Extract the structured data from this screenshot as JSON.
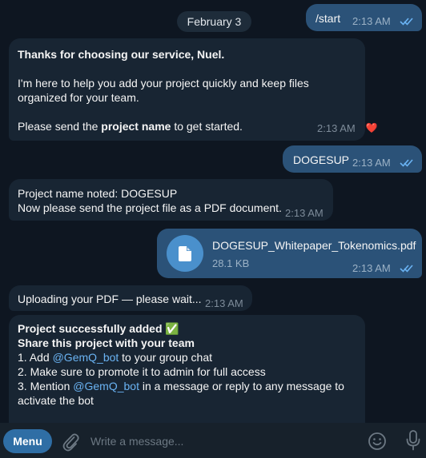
{
  "date_separator": "February 3",
  "messages": [
    {
      "text": "/start",
      "time": "2:13 AM"
    },
    {
      "line1": "Thanks for choosing our service, Nuel.",
      "line2": "I'm here to help you add your project quickly and keep files",
      "line3": "organized for your team.",
      "line4_pre": "Please send the ",
      "line4_bold": "project name",
      "line4_post": " to get started.",
      "time": "2:13 AM",
      "reaction": "❤️"
    },
    {
      "text": "DOGESUP",
      "time": "2:13 AM"
    },
    {
      "line1": "Project name noted: DOGESUP",
      "line2": "Now please send the project file as a PDF document.",
      "time": "2:13 AM"
    },
    {
      "file_name": "DOGESUP_Whitepaper_Tokenomics.pdf",
      "file_size": "28.1 KB",
      "time": "2:13 AM"
    },
    {
      "text": "Uploading your PDF — please wait...",
      "time": "2:13 AM"
    },
    {
      "line1": "Project successfully added ✅",
      "line2": "Share this project with your team",
      "line3_pre": "1. Add ",
      "line3_mention": "@GemQ_bot",
      "line3_post": " to your group chat",
      "line4": "2. Make sure to promote it to admin for full access",
      "line5_pre": "3. Mention ",
      "line5_mention": "@GemQ_bot",
      "line5_post": " in a message or reply to any message to",
      "line6": "activate the bot"
    }
  ],
  "composer": {
    "menu_label": "Menu",
    "placeholder": "Write a message..."
  },
  "colors": {
    "background": "#0e1621",
    "incoming_bubble": "#182533",
    "outgoing_bubble": "#2b5278",
    "accent": "#6ab3f3",
    "menu_button": "#2f6ea5"
  }
}
